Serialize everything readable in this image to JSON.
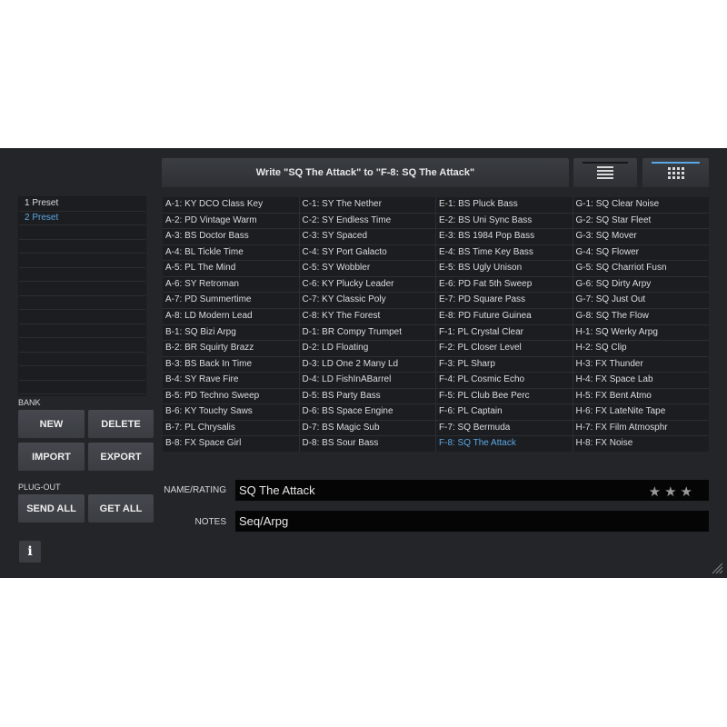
{
  "header": {
    "write_label": "Write \"SQ The Attack\" to \"F-8: SQ The Attack\""
  },
  "bank_list": {
    "items": [
      "1 Preset",
      "2 Preset",
      "",
      "",
      "",
      "",
      "",
      "",
      "",
      "",
      "",
      "",
      "",
      ""
    ],
    "selected_index": 1
  },
  "bank": {
    "label": "BANK",
    "new_label": "NEW",
    "delete_label": "DELETE",
    "import_label": "IMPORT",
    "export_label": "EXPORT"
  },
  "plugout": {
    "label": "PLUG-OUT",
    "send_all_label": "SEND ALL",
    "get_all_label": "GET ALL"
  },
  "info_label": "i",
  "presets": [
    "A-1: KY DCO Class Key",
    "A-2: PD Vintage Warm",
    "A-3: BS Doctor Bass",
    "A-4: BL Tickle Time",
    "A-5: PL The Mind",
    "A-6: SY Retroman",
    "A-7: PD Summertime",
    "A-8: LD Modern Lead",
    "B-1: SQ Bizi Arpg",
    "B-2: BR Squirty Brazz",
    "B-3: BS Back In Time",
    "B-4: SY Rave Fire",
    "B-5: PD Techno Sweep",
    "B-6: KY Touchy Saws",
    "B-7: PL Chrysalis",
    "B-8: FX Space Girl",
    "C-1: SY The Nether",
    "C-2: SY Endless Time",
    "C-3: SY Spaced",
    "C-4: SY Port Galacto",
    "C-5: SY Wobbler",
    "C-6: KY Plucky Leader",
    "C-7: KY Classic Poly",
    "C-8: KY The Forest",
    "D-1: BR Compy Trumpet",
    "D-2: LD Floating",
    "D-3: LD One 2 Many Ld",
    "D-4: LD FishInABarrel",
    "D-5: BS Party Bass",
    "D-6: BS Space Engine",
    "D-7: BS Magic Sub",
    "D-8: BS Sour Bass",
    "E-1: BS Pluck Bass",
    "E-2: BS Uni Sync Bass",
    "E-3: BS 1984 Pop Bass",
    "E-4: BS Time Key Bass",
    "E-5: BS Ugly Unison",
    "E-6: PD Fat 5th Sweep",
    "E-7: PD Square Pass",
    "E-8: PD Future Guinea",
    "F-1: PL Crystal Clear",
    "F-2: PL Closer Level",
    "F-3: PL Sharp",
    "F-4: PL Cosmic Echo",
    "F-5: PL Club Bee Perc",
    "F-6: PL Captain",
    "F-7: SQ Bermuda",
    "F-8: SQ The Attack",
    "G-1: SQ Clear Noise",
    "G-2: SQ Star Fleet",
    "G-3: SQ Mover",
    "G-4: SQ Flower",
    "G-5: SQ Charriot Fusn",
    "G-6: SQ Dirty Arpy",
    "G-7: SQ Just Out",
    "G-8: SQ The Flow",
    "H-1: SQ Werky Arpg",
    "H-2: SQ Clip",
    "H-3: FX Thunder",
    "H-4: FX Space Lab",
    "H-5: FX Bent Atmo",
    "H-6: FX LateNite Tape",
    "H-7: FX Film Atmosphr",
    "H-8: FX Noise"
  ],
  "selected_preset_index": 47,
  "name_rating": {
    "label": "NAME/RATING",
    "value": "SQ The Attack",
    "stars": "★★★"
  },
  "notes": {
    "label": "NOTES",
    "value": "Seq/Arpg"
  },
  "colors": {
    "accent": "#5aa8e6",
    "background": "#232529"
  },
  "icons": {
    "list_view": "list-view-icon",
    "grid_view": "grid-view-icon",
    "resize": "resize-grip-icon"
  }
}
